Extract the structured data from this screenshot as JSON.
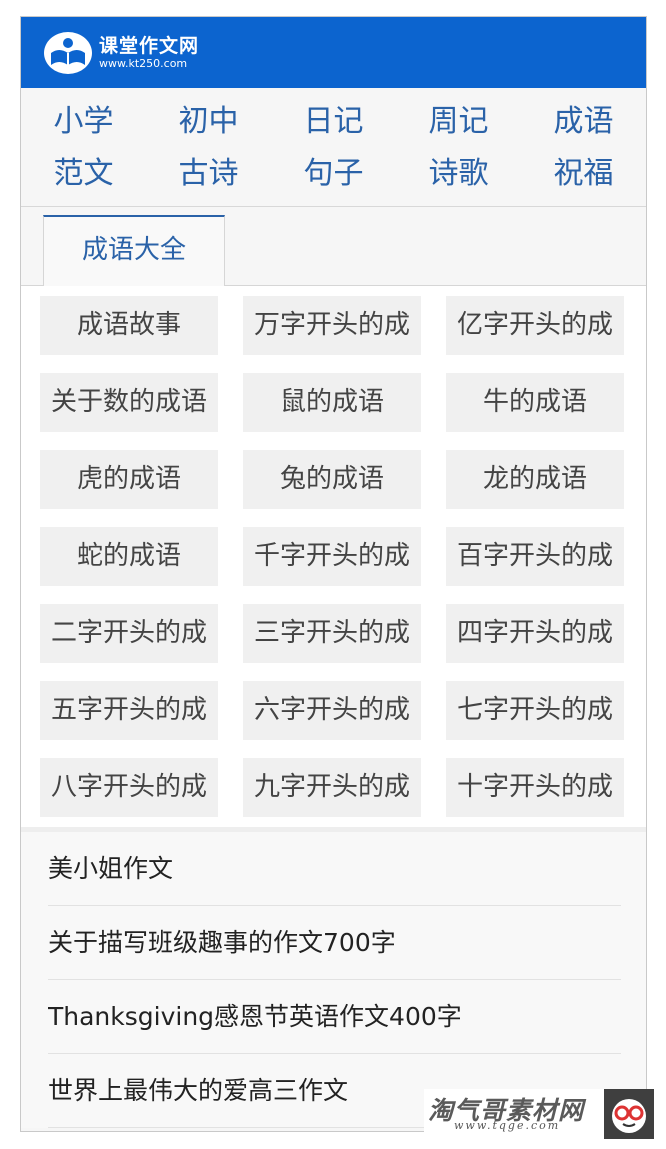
{
  "site": {
    "name": "课堂作文网",
    "url": "www.kt250.com",
    "brand_color": "#0c64cf",
    "logo_icon": "book-hand-logo-icon"
  },
  "nav": {
    "items": [
      {
        "label": "小学"
      },
      {
        "label": "初中"
      },
      {
        "label": "日记"
      },
      {
        "label": "周记"
      },
      {
        "label": "成语"
      },
      {
        "label": "范文"
      },
      {
        "label": "古诗"
      },
      {
        "label": "句子"
      },
      {
        "label": "诗歌"
      },
      {
        "label": "祝福"
      }
    ]
  },
  "tab": {
    "label": "成语大全"
  },
  "idioms": {
    "items": [
      {
        "label": "成语故事"
      },
      {
        "label": "万字开头的成"
      },
      {
        "label": "亿字开头的成"
      },
      {
        "label": "关于数的成语"
      },
      {
        "label": "鼠的成语"
      },
      {
        "label": "牛的成语"
      },
      {
        "label": "虎的成语"
      },
      {
        "label": "兔的成语"
      },
      {
        "label": "龙的成语"
      },
      {
        "label": "蛇的成语"
      },
      {
        "label": "千字开头的成"
      },
      {
        "label": "百字开头的成"
      },
      {
        "label": "二字开头的成"
      },
      {
        "label": "三字开头的成"
      },
      {
        "label": "四字开头的成"
      },
      {
        "label": "五字开头的成"
      },
      {
        "label": "六字开头的成"
      },
      {
        "label": "七字开头的成"
      },
      {
        "label": "八字开头的成"
      },
      {
        "label": "九字开头的成"
      },
      {
        "label": "十字开头的成"
      }
    ]
  },
  "articles": {
    "items": [
      {
        "title": "美小姐作文"
      },
      {
        "title": "关于描写班级趣事的作文700字"
      },
      {
        "title": "Thanksgiving感恩节英语作文400字"
      },
      {
        "title": "世界上最伟大的爱高三作文"
      }
    ]
  },
  "watermark": {
    "text": "淘气哥素材网",
    "url": "www.tqge.com",
    "icon": "glasses-face-icon"
  }
}
